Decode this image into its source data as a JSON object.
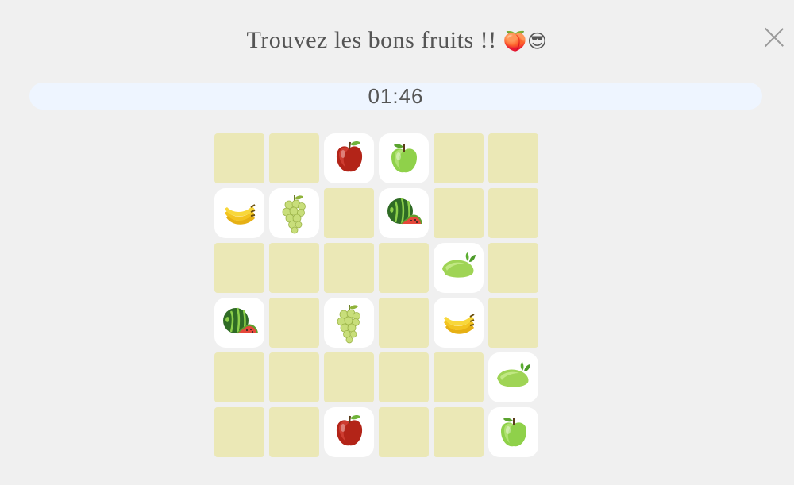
{
  "game": {
    "title": "Trouvez les bons fruits !!",
    "title_emoji": "🍑😎",
    "timer": "01:46",
    "grid": {
      "rows": [
        [
          "",
          "",
          "red-apple",
          "green-apple",
          "",
          ""
        ],
        [
          "banana",
          "grapes",
          "",
          "watermelon",
          "",
          ""
        ],
        [
          "",
          "",
          "",
          "",
          "lime",
          ""
        ],
        [
          "watermelon",
          "",
          "grapes",
          "",
          "banana",
          ""
        ],
        [
          "",
          "",
          "",
          "",
          "",
          "lime"
        ],
        [
          "",
          "",
          "red-apple",
          "",
          "",
          "green-apple"
        ]
      ]
    }
  },
  "colors": {
    "background": "#f0f0f0",
    "hidden_tile": "#ebe8b6",
    "revealed_tile": "#ffffff",
    "timer_bar": "#eef5ff",
    "text": "#555555"
  }
}
